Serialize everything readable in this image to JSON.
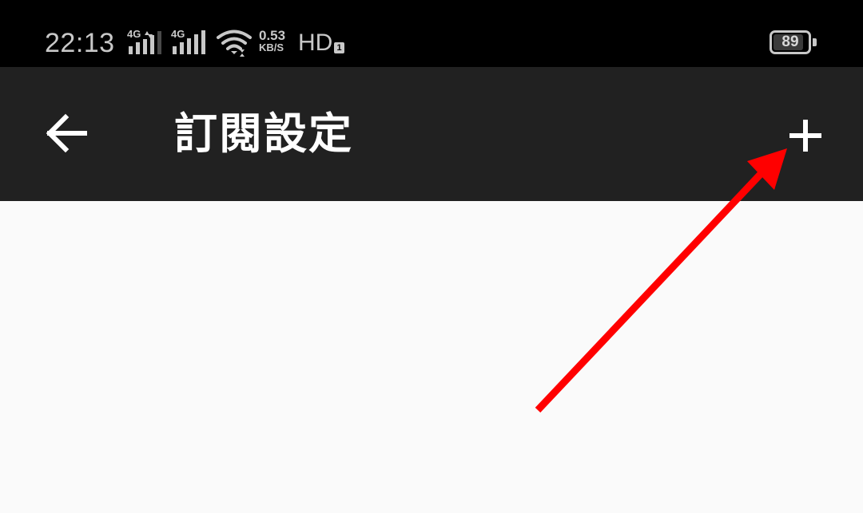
{
  "status_bar": {
    "time": "22:13",
    "signal_1_label": "4G",
    "signal_2_label": "4G",
    "speed_value": "0.53",
    "speed_unit": "KB/S",
    "hd_label": "HD",
    "hd_sub": "1",
    "battery_level": "89",
    "battery_fraction": 0.89,
    "icons": [
      "signal-4g-icon",
      "signal-4g-icon",
      "wifi-icon",
      "battery-icon"
    ]
  },
  "toolbar": {
    "title": "訂閱設定",
    "back_icon": "arrow-left-icon",
    "add_icon": "plus-icon"
  },
  "annotation": {
    "type": "red-arrow",
    "points_to": "add-button",
    "color": "#ff0000"
  },
  "colors": {
    "status_bar_bg": "#000000",
    "toolbar_bg": "#212121",
    "content_bg": "#fafafa",
    "toolbar_text": "#ffffff"
  }
}
